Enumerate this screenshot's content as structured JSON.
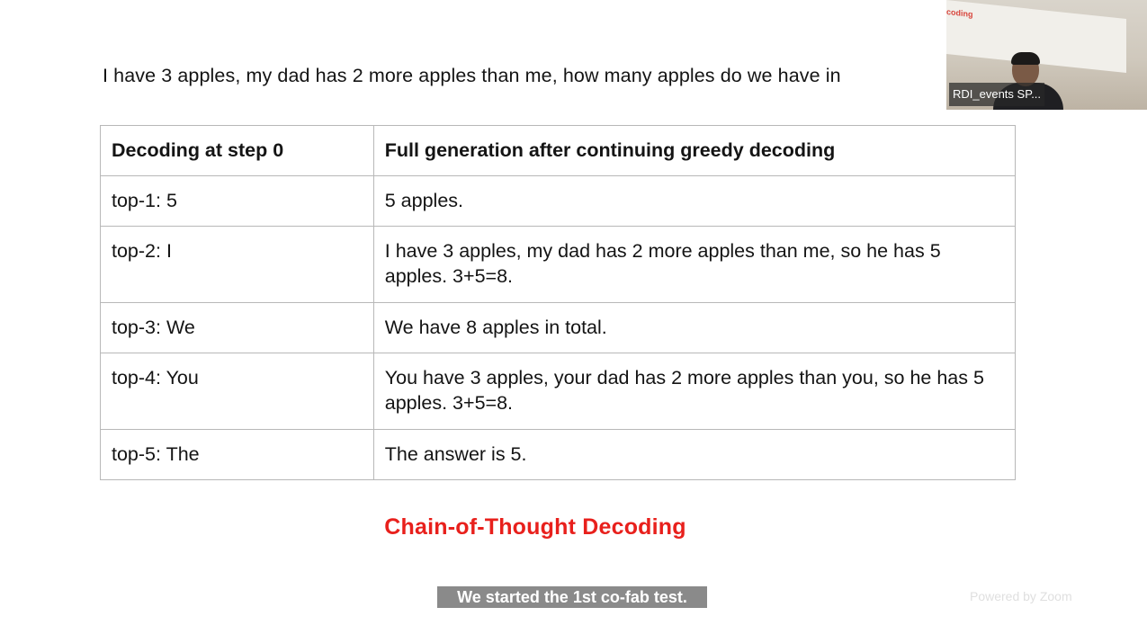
{
  "slide": {
    "question": "I have 3 apples, my dad has 2 more apples than me, how many apples do we have in",
    "table": {
      "headers": [
        "Decoding at step 0",
        "Full generation after continuing greedy decoding"
      ],
      "rows": [
        {
          "step": "top-1: 5",
          "generation": "5 apples."
        },
        {
          "step": "top-2: I",
          "generation": "I have 3 apples, my dad has 2 more apples than me, so he has 5 apples. 3+5=8."
        },
        {
          "step": "top-3: We",
          "generation": "We have 8 apples in total."
        },
        {
          "step": "top-4: You",
          "generation": "You have 3 apples, your dad has 2 more apples than you, so he has 5 apples. 3+5=8."
        },
        {
          "step": "top-5: The",
          "generation": "The answer is 5."
        }
      ]
    },
    "title": "Chain-of-Thought Decoding",
    "title_color": "#e8201c"
  },
  "caption": {
    "text": "We started the 1st co-fab test."
  },
  "video_tile": {
    "participant_name": "RDI_events SP...",
    "screen_text": "coding"
  },
  "watermark": {
    "text": "Powered by Zoom"
  }
}
